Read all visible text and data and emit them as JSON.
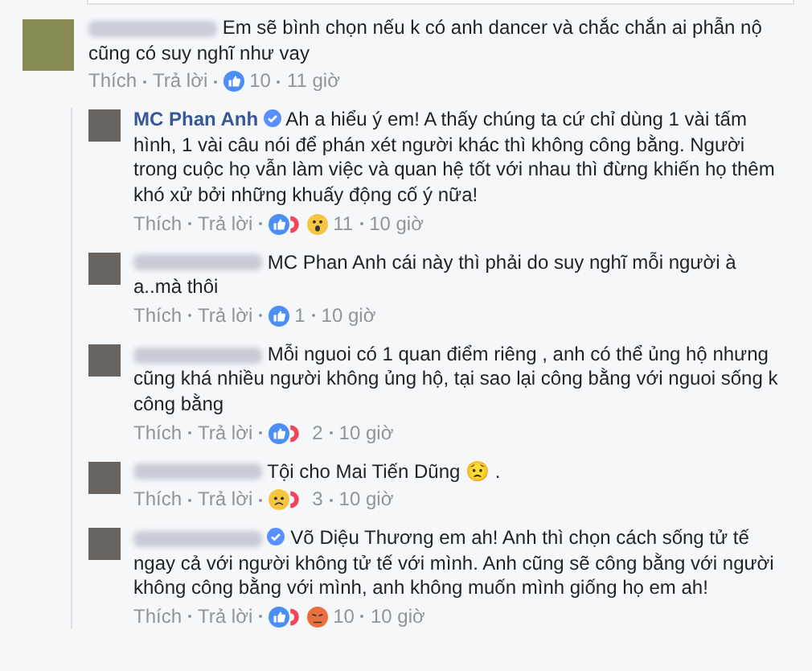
{
  "comments": [
    {
      "author_hidden": true,
      "verified": false,
      "text": "Em sẽ bình chọn nếu k có anh dancer và chắc chắn ai phẫn nộ cũng có suy nghĩ như vay",
      "like": "Thích",
      "reply": "Trả lời",
      "reactions": [
        {
          "kind": "like"
        }
      ],
      "count": "10",
      "time": "11 giờ",
      "children": [
        {
          "author": "MC Phan Anh",
          "author_hidden": false,
          "verified": true,
          "text": "Ah a hiểu ý em! A thấy chúng ta cứ chỉ dùng 1 vài tấm hình, 1 vài câu nói để phán xét người khác thì không công bằng. Người trong cuộc họ vẫn làm việc và quan hệ tốt với nhau thì đừng khiến họ thêm khó xử bởi những khuấy động cố ý nữa!",
          "like": "Thích",
          "reply": "Trả lời",
          "reactions": [
            {
              "kind": "like"
            },
            {
              "kind": "love"
            },
            {
              "kind": "wow"
            }
          ],
          "count": "11",
          "time": "10 giờ"
        },
        {
          "author_hidden": true,
          "verified": false,
          "text": "MC Phan Anh cái này thì phải do suy nghĩ mỗi người à a..mà thôi",
          "like": "Thích",
          "reply": "Trả lời",
          "reactions": [
            {
              "kind": "like"
            }
          ],
          "count": "1",
          "time": "10 giờ"
        },
        {
          "author_hidden": true,
          "verified": false,
          "text": "Mỗi nguoi có 1 quan điểm riêng , anh có thể ủng hộ nhưng cũng khá nhiều người không ủng hộ, tại sao lại công bằng với nguoi sống k công bằng",
          "like": "Thích",
          "reply": "Trả lời",
          "reactions": [
            {
              "kind": "like"
            },
            {
              "kind": "love"
            }
          ],
          "count": "2",
          "time": "10 giờ"
        },
        {
          "author_hidden": true,
          "verified": false,
          "text": "Tội cho Mai Tiến Dũng 😟 .",
          "like": "Thích",
          "reply": "Trả lời",
          "reactions": [
            {
              "kind": "sad"
            },
            {
              "kind": "love"
            }
          ],
          "count": "3",
          "time": "10 giờ"
        },
        {
          "author_hidden": true,
          "verified": true,
          "text": "Võ Diệu Thương em ah! Anh thì chọn cách sống tử tế ngay cả với người không tử tế với mình. Anh cũng sẽ công bằng với người không công bằng với mình, anh không muốn mình giống họ em ah!",
          "like": "Thích",
          "reply": "Trả lời",
          "reactions": [
            {
              "kind": "like"
            },
            {
              "kind": "love"
            },
            {
              "kind": "angry"
            }
          ],
          "count": "10",
          "time": "10 giờ"
        }
      ]
    }
  ]
}
